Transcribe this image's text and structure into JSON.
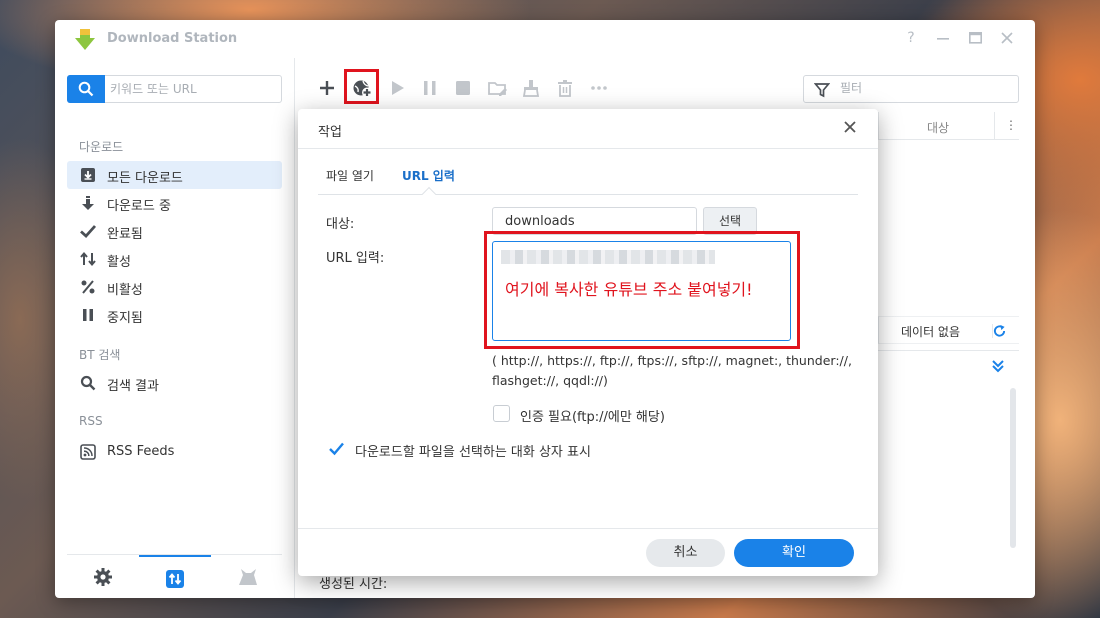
{
  "window": {
    "title": "Download Station"
  },
  "sidebar": {
    "search_placeholder": "키워드 또는 URL",
    "sections": {
      "download": "다운로드",
      "bt": "BT 검색",
      "rss": "RSS"
    },
    "items": [
      {
        "label": "모든 다운로드",
        "icon": "download-box-icon",
        "active": true
      },
      {
        "label": "다운로드 중",
        "icon": "arrow-down-icon"
      },
      {
        "label": "완료됨",
        "icon": "check-icon"
      },
      {
        "label": "활성",
        "icon": "up-down-arrows-icon"
      },
      {
        "label": "비활성",
        "icon": "percent-icon"
      },
      {
        "label": "중지됨",
        "icon": "pause-icon"
      },
      {
        "label": "검색 결과",
        "icon": "search-icon"
      },
      {
        "label": "RSS Feeds",
        "icon": "rss-icon"
      }
    ],
    "bottom_tabs": [
      "gear-icon",
      "transfer-icon",
      "emule-icon"
    ]
  },
  "toolbar": {
    "buttons": [
      "add-icon",
      "add-url-icon",
      "play-icon",
      "pause-icon",
      "stop-icon",
      "folder-edit-icon",
      "clear-icon",
      "delete-icon",
      "more-icon"
    ],
    "filter_placeholder": "필터"
  },
  "list": {
    "column_target": "대상",
    "status_text": "데이터 없음",
    "created_time_label": "생성된 시간:"
  },
  "dialog": {
    "title": "작업",
    "tabs": [
      "파일 열기",
      "URL 입력"
    ],
    "active_tab": "URL 입력",
    "dest_label": "대상:",
    "dest_value": "downloads",
    "select_button": "선택",
    "url_label": "URL 입력:",
    "annotation": "여기에 복사한 유튜브 주소 붙여넣기!",
    "protocols": "( http://, https://, ftp://, ftps://, sftp://, magnet:, thunder://, flashget://, qqdl://)",
    "auth_label": "인증 필요(ftp://에만 해당)",
    "auth_checked": false,
    "show_dialog_label": "다운로드할 파일을 선택하는 대화 상자 표시",
    "show_dialog_checked": true,
    "cancel_button": "취소",
    "ok_button": "확인"
  },
  "colors": {
    "accent": "#1a82e8",
    "highlight": "#e0141e"
  }
}
